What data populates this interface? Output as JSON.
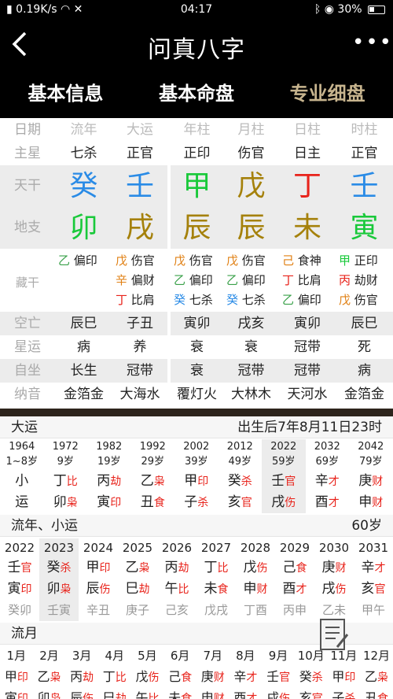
{
  "status": {
    "speed": "0.19K/s",
    "time": "04:17",
    "battery": "30%"
  },
  "header": {
    "title": "问真八字",
    "more": "•••"
  },
  "tabs": [
    "基本信息",
    "基本命盘",
    "专业细盘"
  ],
  "table": {
    "headers": [
      "日期",
      "流年",
      "大运",
      "年柱",
      "月柱",
      "日柱",
      "时柱"
    ],
    "zhuxing": {
      "label": "主星",
      "values": [
        "七杀",
        "正官",
        "正印",
        "伤官",
        "日主",
        "正官"
      ]
    },
    "tiangan": {
      "label": "天干",
      "values": [
        "癸",
        "壬",
        "甲",
        "戊",
        "丁",
        "壬"
      ]
    },
    "dizhi": {
      "label": "地支",
      "values": [
        "卯",
        "戌",
        "辰",
        "辰",
        "未",
        "寅"
      ]
    },
    "canggan": {
      "label": "藏干",
      "cols": [
        [
          [
            "乙",
            "偏印"
          ]
        ],
        [
          [
            "戊",
            "伤官"
          ],
          [
            "辛",
            "偏财"
          ],
          [
            "丁",
            "比肩"
          ]
        ],
        [
          [
            "戊",
            "伤官"
          ],
          [
            "乙",
            "偏印"
          ],
          [
            "癸",
            "七杀"
          ]
        ],
        [
          [
            "戊",
            "伤官"
          ],
          [
            "乙",
            "偏印"
          ],
          [
            "癸",
            "七杀"
          ]
        ],
        [
          [
            "己",
            "食神"
          ],
          [
            "丁",
            "比肩"
          ],
          [
            "乙",
            "偏印"
          ]
        ],
        [
          [
            "甲",
            "正印"
          ],
          [
            "丙",
            "劫财"
          ],
          [
            "戊",
            "伤官"
          ]
        ]
      ]
    },
    "kongwang": {
      "label": "空亡",
      "values": [
        "辰巳",
        "子丑",
        "寅卯",
        "戌亥",
        "寅卯",
        "辰巳"
      ]
    },
    "xingyun": {
      "label": "星运",
      "values": [
        "病",
        "养",
        "衰",
        "衰",
        "冠带",
        "死"
      ]
    },
    "zizuo": {
      "label": "自坐",
      "values": [
        "长生",
        "冠带",
        "衰",
        "冠带",
        "冠带",
        "病"
      ]
    },
    "nayin": {
      "label": "纳音",
      "values": [
        "金箔金",
        "大海水",
        "覆灯火",
        "大林木",
        "天河水",
        "金箔金"
      ]
    }
  },
  "dayun": {
    "label": "大运",
    "info": "出生后7年8月11日23时",
    "cols": [
      {
        "year": "1964",
        "age": "1~8岁",
        "gan": "小",
        "gan_tag": "",
        "zhi": "运",
        "zhi_tag": ""
      },
      {
        "year": "1972",
        "age": "9岁",
        "gan": "丁",
        "gan_tag": "比",
        "zhi": "卯",
        "zhi_tag": "枭"
      },
      {
        "year": "1982",
        "age": "19岁",
        "gan": "丙",
        "gan_tag": "劫",
        "zhi": "寅",
        "zhi_tag": "印"
      },
      {
        "year": "1992",
        "age": "29岁",
        "gan": "乙",
        "gan_tag": "枭",
        "zhi": "丑",
        "zhi_tag": "食"
      },
      {
        "year": "2002",
        "age": "39岁",
        "gan": "甲",
        "gan_tag": "印",
        "zhi": "子",
        "zhi_tag": "杀"
      },
      {
        "year": "2012",
        "age": "49岁",
        "gan": "癸",
        "gan_tag": "杀",
        "zhi": "亥",
        "zhi_tag": "官"
      },
      {
        "year": "2022",
        "age": "59岁",
        "gan": "壬",
        "gan_tag": "官",
        "zhi": "戌",
        "zhi_tag": "伤"
      },
      {
        "year": "2032",
        "age": "69岁",
        "gan": "辛",
        "gan_tag": "才",
        "zhi": "酉",
        "zhi_tag": "才"
      },
      {
        "year": "2042",
        "age": "79岁",
        "gan": "庚",
        "gan_tag": "财",
        "zhi": "申",
        "zhi_tag": "财"
      }
    ]
  },
  "liunian": {
    "label": "流年、小运",
    "age": "60岁",
    "cols": [
      {
        "year": "2022",
        "gan": "壬",
        "gan_tag": "官",
        "zhi": "寅",
        "zhi_tag": "印",
        "xy": "癸卯"
      },
      {
        "year": "2023",
        "gan": "癸",
        "gan_tag": "杀",
        "zhi": "卯",
        "zhi_tag": "枭",
        "xy": "壬寅"
      },
      {
        "year": "2024",
        "gan": "甲",
        "gan_tag": "印",
        "zhi": "辰",
        "zhi_tag": "伤",
        "xy": "辛丑"
      },
      {
        "year": "2025",
        "gan": "乙",
        "gan_tag": "枭",
        "zhi": "巳",
        "zhi_tag": "劫",
        "xy": "庚子"
      },
      {
        "year": "2026",
        "gan": "丙",
        "gan_tag": "劫",
        "zhi": "午",
        "zhi_tag": "比",
        "xy": "己亥"
      },
      {
        "year": "2027",
        "gan": "丁",
        "gan_tag": "比",
        "zhi": "未",
        "zhi_tag": "食",
        "xy": "戊戌"
      },
      {
        "year": "2028",
        "gan": "戊",
        "gan_tag": "伤",
        "zhi": "申",
        "zhi_tag": "财",
        "xy": "丁酉"
      },
      {
        "year": "2029",
        "gan": "己",
        "gan_tag": "食",
        "zhi": "酉",
        "zhi_tag": "才",
        "xy": "丙申"
      },
      {
        "year": "2030",
        "gan": "庚",
        "gan_tag": "财",
        "zhi": "戌",
        "zhi_tag": "伤",
        "xy": "乙未"
      },
      {
        "year": "2031",
        "gan": "辛",
        "gan_tag": "才",
        "zhi": "亥",
        "zhi_tag": "官",
        "xy": "甲午"
      }
    ]
  },
  "liuyue": {
    "label": "流月",
    "cols": [
      {
        "month": "1月",
        "gan": "甲",
        "gan_tag": "印",
        "zhi": "寅",
        "zhi_tag": "印"
      },
      {
        "month": "2月",
        "gan": "乙",
        "gan_tag": "枭",
        "zhi": "卯",
        "zhi_tag": "枭"
      },
      {
        "month": "3月",
        "gan": "丙",
        "gan_tag": "劫",
        "zhi": "辰",
        "zhi_tag": "伤"
      },
      {
        "month": "4月",
        "gan": "丁",
        "gan_tag": "比",
        "zhi": "巳",
        "zhi_tag": "劫"
      },
      {
        "month": "5月",
        "gan": "戊",
        "gan_tag": "伤",
        "zhi": "午",
        "zhi_tag": "比"
      },
      {
        "month": "6月",
        "gan": "己",
        "gan_tag": "食",
        "zhi": "未",
        "zhi_tag": "食"
      },
      {
        "month": "7月",
        "gan": "庚",
        "gan_tag": "财",
        "zhi": "申",
        "zhi_tag": "财"
      },
      {
        "month": "8月",
        "gan": "辛",
        "gan_tag": "才",
        "zhi": "酉",
        "zhi_tag": "才"
      },
      {
        "month": "9月",
        "gan": "壬",
        "gan_tag": "官",
        "zhi": "戌",
        "zhi_tag": "伤"
      },
      {
        "month": "10月",
        "gan": "癸",
        "gan_tag": "杀",
        "zhi": "亥",
        "zhi_tag": "官"
      },
      {
        "month": "11月",
        "gan": "甲",
        "gan_tag": "印",
        "zhi": "子",
        "zhi_tag": "杀"
      },
      {
        "month": "12月",
        "gan": "乙",
        "gan_tag": "枭",
        "zhi": "丑",
        "zhi_tag": "食"
      }
    ]
  },
  "colors": {
    "tiangan": [
      "#2a8be6",
      "#2a8be6",
      "#19c93a",
      "#a5810b",
      "#e8231b",
      "#2a8be6"
    ],
    "dizhi": [
      "#19c93a",
      "#a5810b",
      "#a5810b",
      "#a5810b",
      "#a5810b",
      "#19c93a"
    ],
    "tab_active": "#c7b48e",
    "tag": "#e8231b"
  },
  "icons": {
    "back": "chevron-left-icon",
    "more": "more-dots-icon",
    "note": "note-icon"
  }
}
